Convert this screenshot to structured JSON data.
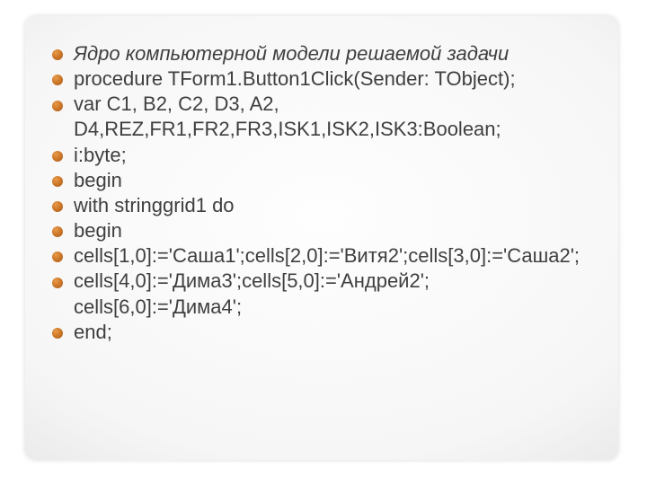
{
  "lines": [
    {
      "text": "Ядро компьютерной модели решаемой задачи",
      "italic": true
    },
    {
      "text": "procedure TForm1.Button1Click(Sender: TObject);",
      "italic": false
    },
    {
      "text": "var C1, B2, C2, D3, A2, D4,REZ,FR1,FR2,FR3,ISK1,ISK2,ISK3:Boolean;",
      "italic": false
    },
    {
      "text": "    i:byte;",
      "italic": false
    },
    {
      "text": "begin",
      "italic": false
    },
    {
      "text": "with stringgrid1 do",
      "italic": false
    },
    {
      "text": "begin",
      "italic": false
    },
    {
      "text": "cells[1,0]:='Саша1';cells[2,0]:='Витя2';cells[3,0]:='Саша2';",
      "italic": false
    },
    {
      "text": "cells[4,0]:='Дима3';cells[5,0]:='Андрей2'; cells[6,0]:='Дима4';",
      "italic": false
    },
    {
      "text": "end;",
      "italic": false
    }
  ]
}
